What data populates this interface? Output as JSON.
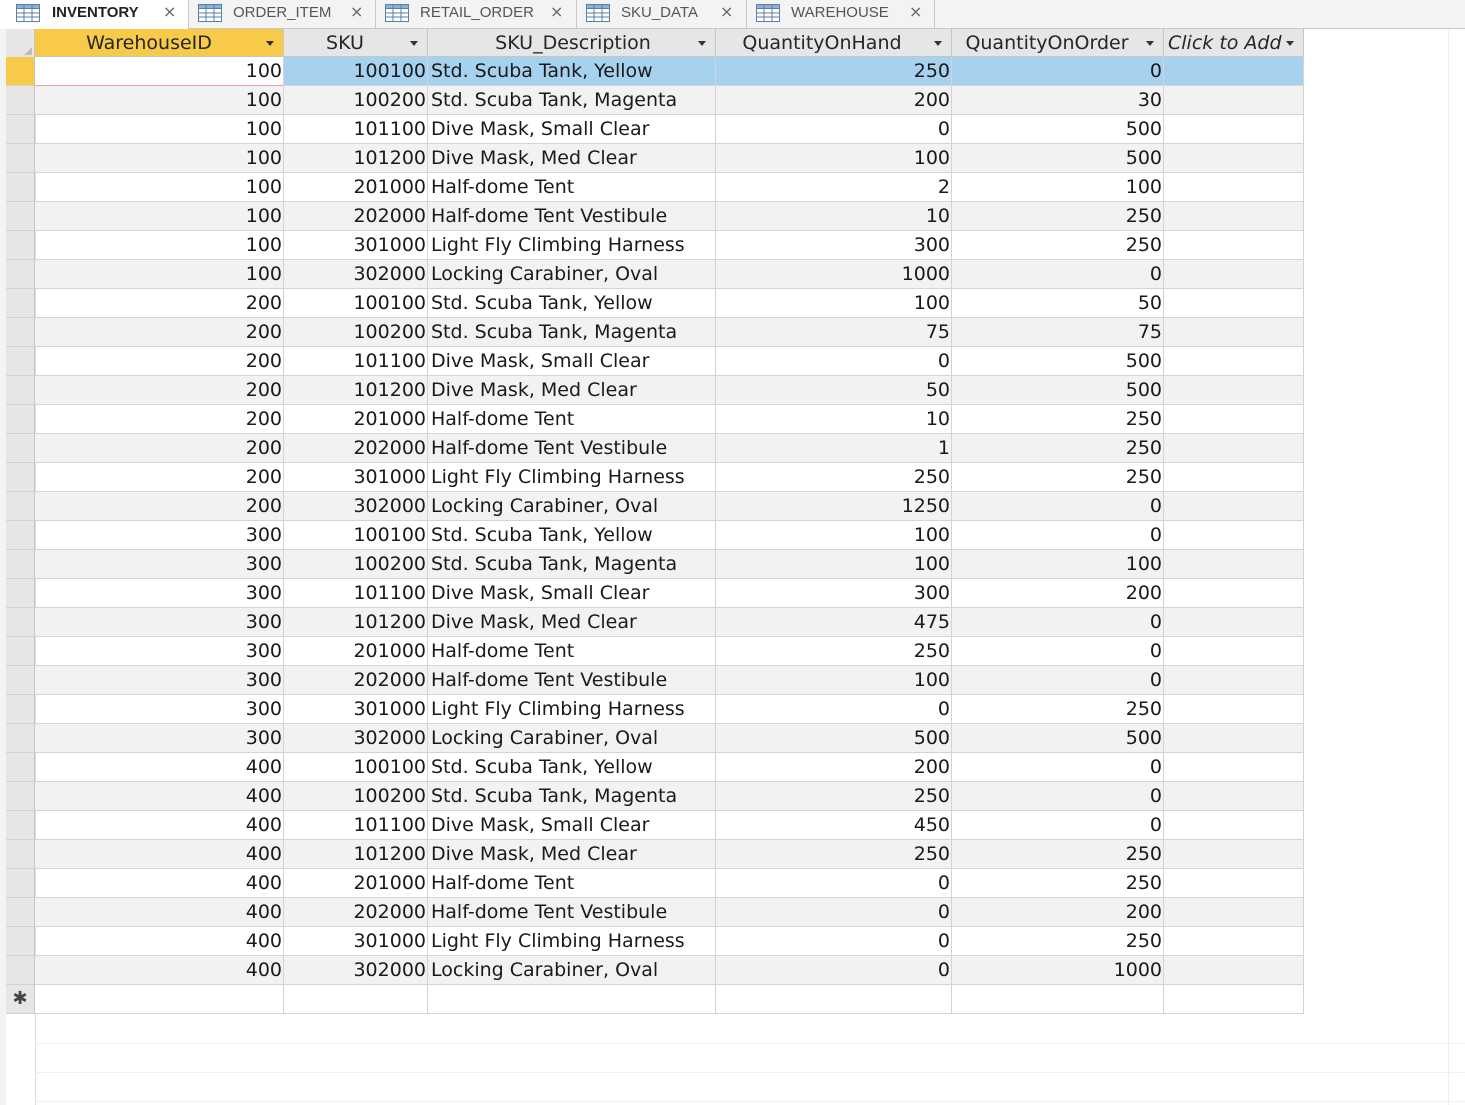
{
  "tabs": [
    {
      "label": "INVENTORY",
      "active": true
    },
    {
      "label": "ORDER_ITEM",
      "active": false
    },
    {
      "label": "RETAIL_ORDER",
      "active": false
    },
    {
      "label": "SKU_DATA",
      "active": false
    },
    {
      "label": "WAREHOUSE",
      "active": false
    }
  ],
  "close_glyph": "×",
  "columns": [
    "WarehouseID",
    "SKU",
    "SKU_Description",
    "QuantityOnHand",
    "QuantityOnOrder",
    "Click to Add"
  ],
  "new_record_glyph": "✱",
  "colors": {
    "active_header": "#f7ca4a",
    "selected_row": "#a6d2f0",
    "alt_row": "#f2f2f2"
  },
  "rows": [
    [
      "100",
      "100100",
      "Std. Scuba Tank, Yellow",
      "250",
      "0"
    ],
    [
      "100",
      "100200",
      "Std. Scuba Tank, Magenta",
      "200",
      "30"
    ],
    [
      "100",
      "101100",
      "Dive Mask, Small Clear",
      "0",
      "500"
    ],
    [
      "100",
      "101200",
      "Dive Mask, Med Clear",
      "100",
      "500"
    ],
    [
      "100",
      "201000",
      "Half-dome Tent",
      "2",
      "100"
    ],
    [
      "100",
      "202000",
      "Half-dome Tent Vestibule",
      "10",
      "250"
    ],
    [
      "100",
      "301000",
      "Light Fly Climbing Harness",
      "300",
      "250"
    ],
    [
      "100",
      "302000",
      "Locking Carabiner, Oval",
      "1000",
      "0"
    ],
    [
      "200",
      "100100",
      "Std. Scuba Tank, Yellow",
      "100",
      "50"
    ],
    [
      "200",
      "100200",
      "Std. Scuba Tank, Magenta",
      "75",
      "75"
    ],
    [
      "200",
      "101100",
      "Dive Mask, Small Clear",
      "0",
      "500"
    ],
    [
      "200",
      "101200",
      "Dive Mask, Med Clear",
      "50",
      "500"
    ],
    [
      "200",
      "201000",
      "Half-dome Tent",
      "10",
      "250"
    ],
    [
      "200",
      "202000",
      "Half-dome Tent Vestibule",
      "1",
      "250"
    ],
    [
      "200",
      "301000",
      "Light Fly Climbing Harness",
      "250",
      "250"
    ],
    [
      "200",
      "302000",
      "Locking Carabiner, Oval",
      "1250",
      "0"
    ],
    [
      "300",
      "100100",
      "Std. Scuba Tank, Yellow",
      "100",
      "0"
    ],
    [
      "300",
      "100200",
      "Std. Scuba Tank, Magenta",
      "100",
      "100"
    ],
    [
      "300",
      "101100",
      "Dive Mask, Small Clear",
      "300",
      "200"
    ],
    [
      "300",
      "101200",
      "Dive Mask, Med Clear",
      "475",
      "0"
    ],
    [
      "300",
      "201000",
      "Half-dome Tent",
      "250",
      "0"
    ],
    [
      "300",
      "202000",
      "Half-dome Tent Vestibule",
      "100",
      "0"
    ],
    [
      "300",
      "301000",
      "Light Fly Climbing Harness",
      "0",
      "250"
    ],
    [
      "300",
      "302000",
      "Locking Carabiner, Oval",
      "500",
      "500"
    ],
    [
      "400",
      "100100",
      "Std. Scuba Tank, Yellow",
      "200",
      "0"
    ],
    [
      "400",
      "100200",
      "Std. Scuba Tank, Magenta",
      "250",
      "0"
    ],
    [
      "400",
      "101100",
      "Dive Mask, Small Clear",
      "450",
      "0"
    ],
    [
      "400",
      "101200",
      "Dive Mask, Med Clear",
      "250",
      "250"
    ],
    [
      "400",
      "201000",
      "Half-dome Tent",
      "0",
      "250"
    ],
    [
      "400",
      "202000",
      "Half-dome Tent Vestibule",
      "0",
      "200"
    ],
    [
      "400",
      "301000",
      "Light Fly Climbing Harness",
      "0",
      "250"
    ],
    [
      "400",
      "302000",
      "Locking Carabiner, Oval",
      "0",
      "1000"
    ]
  ]
}
